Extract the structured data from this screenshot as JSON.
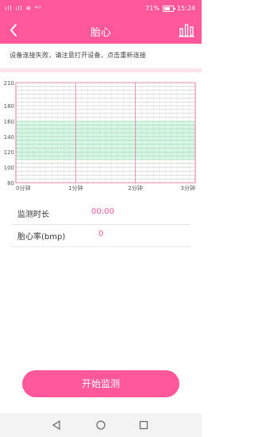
{
  "status": {
    "left_icons": "ıll ıll ≋ ⁴ᴳ",
    "battery": "71%",
    "time": "15:24"
  },
  "nav": {
    "title": "胎心",
    "back_icon": "chevron-left-icon",
    "stats_icon": "bar-chart-icon"
  },
  "notice": "设备连接失败，请注意打开设备，点击重新连接",
  "chart_data": {
    "type": "line",
    "title": "",
    "x_tick_labels": [
      "0分钟",
      "1分钟",
      "2分钟",
      "3分钟"
    ],
    "xlim": [
      0,
      3
    ],
    "ylim": [
      80,
      210
    ],
    "y_tick_labels": [
      "80",
      "100",
      "120",
      "140",
      "160",
      "180",
      "210"
    ],
    "y_ticks": [
      80,
      100,
      120,
      140,
      160,
      180,
      210
    ],
    "normal_band": [
      110,
      160
    ],
    "grid": true,
    "series": [
      {
        "values": []
      }
    ],
    "colors": {
      "grid_minor": "#bdbdbd",
      "grid_major": "#e9739f",
      "band": "#d8f5e6",
      "band_line": "#7fd6a6"
    }
  },
  "info": {
    "duration_label": "监测时长",
    "duration_value": "00:00",
    "heart_rate_label": "胎心率(bmp)",
    "heart_rate_value": "0"
  },
  "start_button": "开始监测",
  "system_nav": {
    "back_icon": "triangle-back-icon",
    "home_icon": "circle-home-icon",
    "recent_icon": "square-recent-icon"
  },
  "colors": {
    "accent": "#ff579a"
  }
}
